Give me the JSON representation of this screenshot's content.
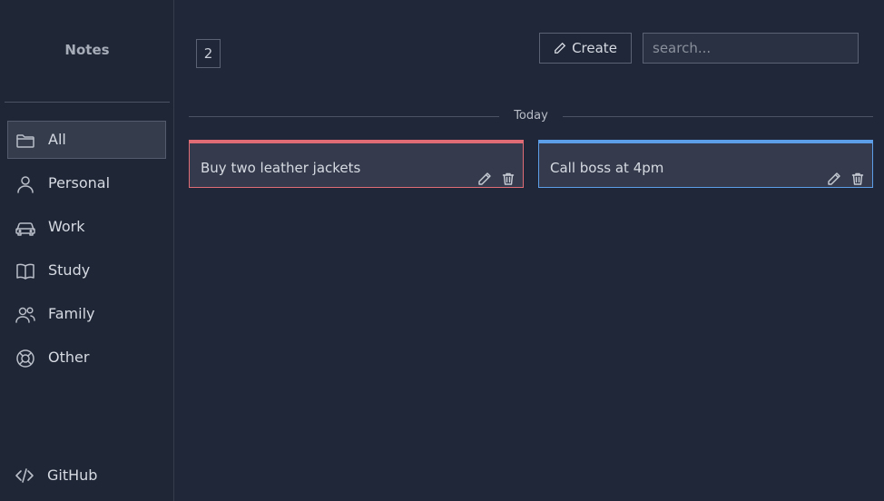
{
  "app": {
    "title": "Notes"
  },
  "sidebar": {
    "items": [
      {
        "label": "All",
        "icon": "folder-icon",
        "active": true
      },
      {
        "label": "Personal",
        "icon": "user-icon"
      },
      {
        "label": "Work",
        "icon": "car-icon"
      },
      {
        "label": "Study",
        "icon": "book-icon"
      },
      {
        "label": "Family",
        "icon": "users-icon"
      },
      {
        "label": "Other",
        "icon": "lifebuoy-icon"
      }
    ],
    "github": {
      "label": "GitHub",
      "icon": "code-icon"
    }
  },
  "toolbar": {
    "count": "2",
    "create_label": "Create",
    "search_placeholder": "search..."
  },
  "section": {
    "label": "Today"
  },
  "notes": [
    {
      "title": "Buy two leather jackets",
      "accent": "#e06c75"
    },
    {
      "title": "Call boss at 4pm",
      "accent": "#5c9ee8"
    }
  ]
}
